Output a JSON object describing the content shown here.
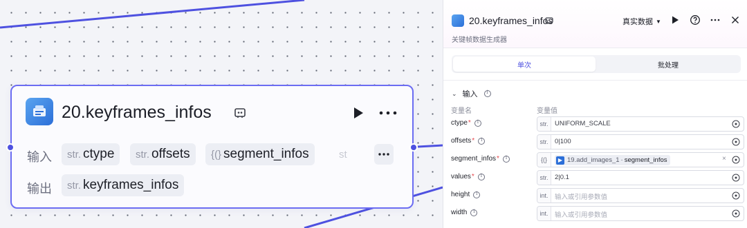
{
  "node": {
    "title": "20.keyframes_infos",
    "input_label": "输入",
    "output_label": "输出",
    "inputs": [
      {
        "type": "str.",
        "name": "ctype"
      },
      {
        "type": "str.",
        "name": "offsets"
      },
      {
        "type": "{(}",
        "name": "segment_infos"
      },
      {
        "type": "st",
        "name": ""
      }
    ],
    "outputs": [
      {
        "type": "str.",
        "name": "keyframes_infos"
      }
    ]
  },
  "panel": {
    "title": "20.keyframes_infos",
    "subtitle": "关键帧数据生成器",
    "data_mode": "真实数据",
    "tabs": [
      {
        "label": "单次",
        "active": true
      },
      {
        "label": "批处理",
        "active": false
      }
    ],
    "section_label": "输入",
    "col_name": "变量名",
    "col_value": "变量值",
    "fields": [
      {
        "name": "ctype",
        "required": true,
        "type": "str.",
        "value": "UNIFORM_SCALE"
      },
      {
        "name": "offsets",
        "required": true,
        "type": "str.",
        "value": "0|100"
      },
      {
        "name": "segment_infos",
        "required": true,
        "type": "{(}",
        "ref_source": "19.add_images_1",
        "ref_sep": "-",
        "ref_field": "segment_infos"
      },
      {
        "name": "values",
        "required": true,
        "type": "str.",
        "value": "2|0.1"
      },
      {
        "name": "height",
        "required": false,
        "type": "int.",
        "placeholder": "输入或引用参数值"
      },
      {
        "name": "width",
        "required": false,
        "type": "int.",
        "placeholder": "输入或引用参数值"
      }
    ]
  },
  "colors": {
    "accent": "#4e51e0",
    "node_border": "#6b6cf2",
    "edge": "#4e51e0",
    "required": "#e5484d"
  }
}
